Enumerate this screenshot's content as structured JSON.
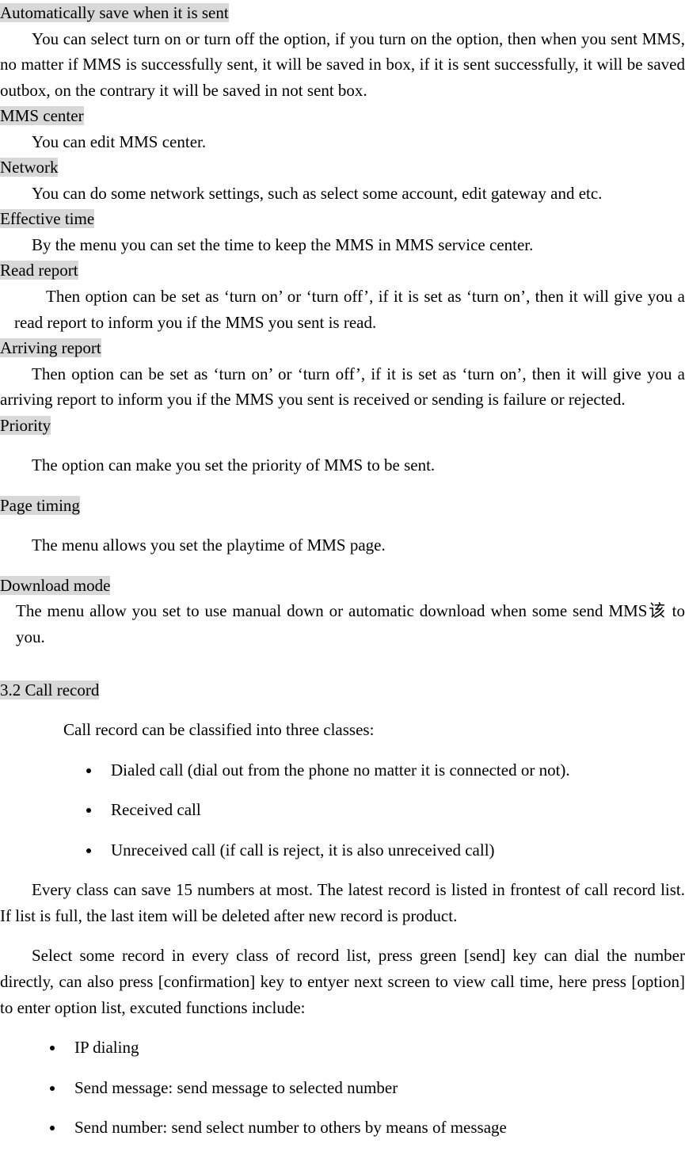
{
  "s1": {
    "h": "Automatically save when it is sent",
    "p": "You can select turn on or turn off the option, if you turn on the option, then when you sent MMS, no matter if MMS is successfully sent, it will be saved in box, if it is sent successfully, it will be saved outbox, on the contrary it will be saved in not sent box."
  },
  "s2": {
    "h": "MMS center",
    "p": "You can edit MMS center."
  },
  "s3": {
    "h": "Network",
    "p": "You can do some network settings, such as select some account, edit gateway and etc."
  },
  "s4": {
    "h": "Effective time",
    "p": "By the menu you can set the time to keep the MMS in MMS service center."
  },
  "s5": {
    "h": "Read report",
    "p": "Then option can be set as ‘turn on’ or ‘turn off’, if it is set as ‘turn on’, then it will give you a read report to inform you if the MMS you sent is read."
  },
  "s6": {
    "h": "Arriving report",
    "p": "Then option can be set as ‘turn on’ or ‘turn off’, if it is set as ‘turn on’, then it will give you a arriving report to inform you if the MMS you sent is received or sending is failure or rejected."
  },
  "s7": {
    "h": "Priority",
    "p": "The option can make you set the priority of MMS to be sent."
  },
  "s8": {
    "h": "Page timing",
    "p": "The menu allows you set the playtime of MMS page."
  },
  "s9": {
    "h": "Download mode",
    "p": "The menu allow you set to use manual down or automatic download when some send MMS该 to you."
  },
  "s10": {
    "h": "3.2 Call record  ",
    "intro": "Call record can be classified into three classes:",
    "b1": "Dialed call (dial out from the phone no matter it is connected or not).",
    "b2": "Received call",
    "b3": "Unreceived call (if call is reject, it is also unreceived call)",
    "p2": "Every class can save 15 numbers at most. The latest record is listed in frontest of call record list. If list is full, the last item will be deleted after new record is product.",
    "p3": "Select some record in every class of record list, press green [send] key can dial the number directly, can also press [confirmation] key to entyer next screen to view call time, here press [option] to enter option list, excuted functions include:",
    "c1": "IP dialing",
    "c2": "Send message: send message to selected number",
    "c3": "Send number: send select number to others by means of message"
  }
}
